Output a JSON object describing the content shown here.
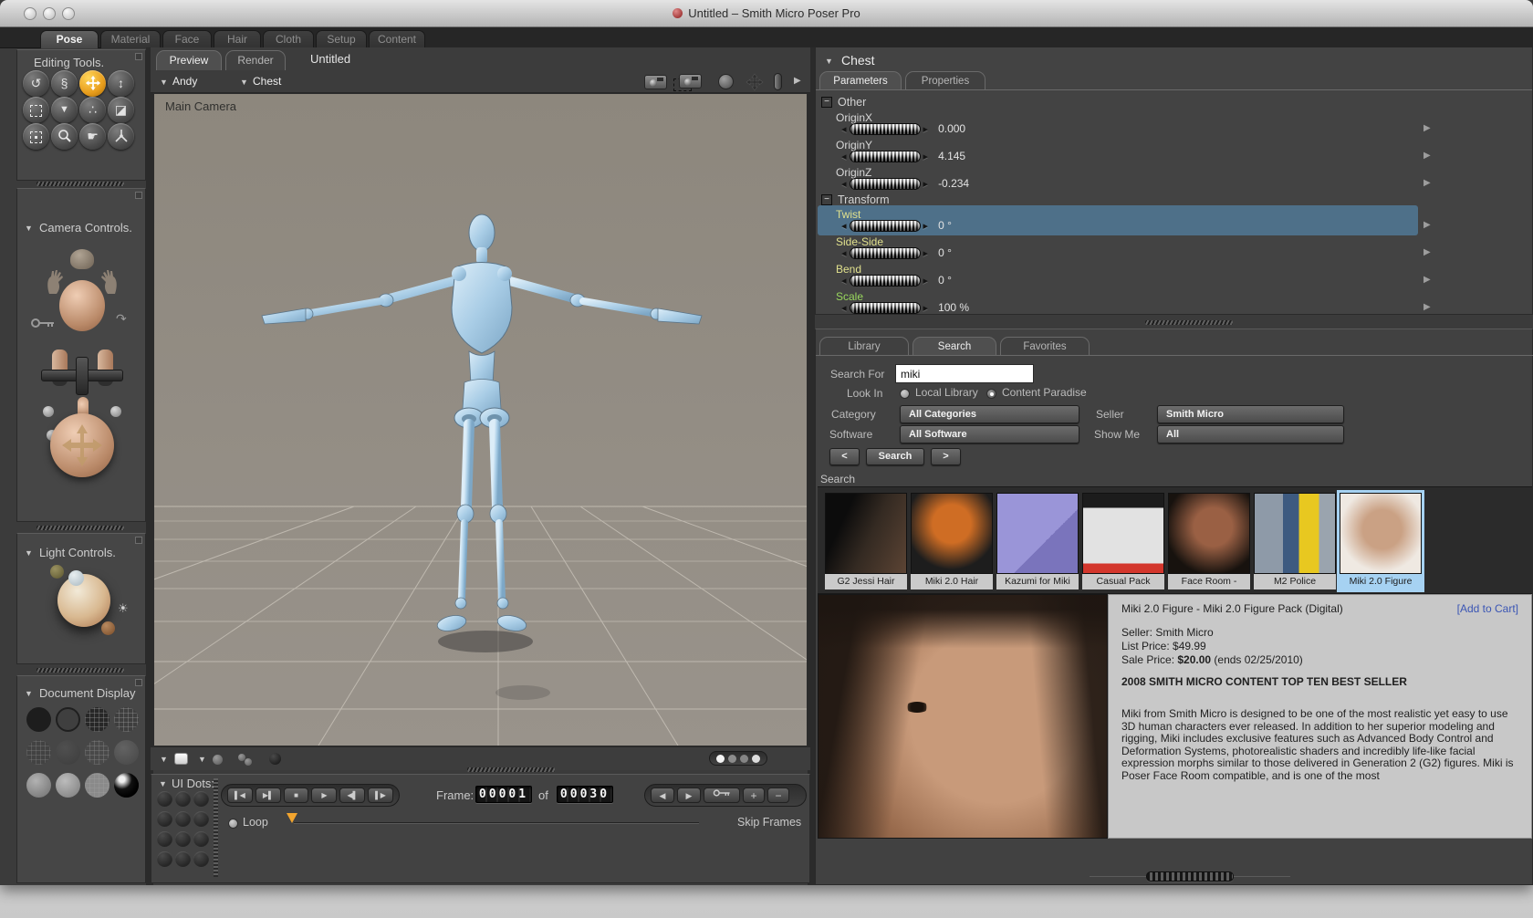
{
  "window": {
    "title": "Untitled – Smith Micro Poser Pro"
  },
  "room_tabs": [
    {
      "label": "Pose"
    },
    {
      "label": "Material"
    },
    {
      "label": "Face"
    },
    {
      "label": "Hair"
    },
    {
      "label": "Cloth"
    },
    {
      "label": "Setup"
    },
    {
      "label": "Content"
    }
  ],
  "left": {
    "editing_tools": {
      "title": "Editing Tools."
    },
    "camera_controls": {
      "title": "Camera Controls."
    },
    "light_controls": {
      "title": "Light Controls."
    },
    "document_display": {
      "title": "Document Display"
    }
  },
  "document": {
    "tab_preview": "Preview",
    "tab_render": "Render",
    "name": "Untitled",
    "actor_figure": "Andy",
    "actor_part": "Chest",
    "camera_label": "Main Camera"
  },
  "animation": {
    "ui_dots": "UI Dots:",
    "frame_label": "Frame:",
    "frame_current": "00001",
    "of_label": "of",
    "frame_total": "00030",
    "loop": "Loop",
    "skip": "Skip Frames"
  },
  "parameters": {
    "actor": "Chest",
    "tab_parameters": "Parameters",
    "tab_properties": "Properties",
    "groups": {
      "other": {
        "name": "Other",
        "params": [
          {
            "label": "OriginX",
            "value": "0.000"
          },
          {
            "label": "OriginY",
            "value": "4.145"
          },
          {
            "label": "OriginZ",
            "value": "-0.234"
          }
        ]
      },
      "transform": {
        "name": "Transform",
        "params": [
          {
            "label": "Twist",
            "value": "0 °"
          },
          {
            "label": "Side-Side",
            "value": "0 °"
          },
          {
            "label": "Bend",
            "value": "0 °"
          },
          {
            "label": "Scale",
            "value": "100 %"
          }
        ]
      }
    }
  },
  "library": {
    "tab_library": "Library",
    "tab_search": "Search",
    "tab_favorites": "Favorites",
    "search_for_label": "Search For",
    "search_value": "miki",
    "look_in_label": "Look In",
    "radio_local": "Local Library",
    "radio_paradise": "Content Paradise",
    "category_label": "Category",
    "category_value": "All Categories",
    "seller_label": "Seller",
    "seller_value": "Smith Micro",
    "software_label": "Software",
    "software_value": "All Software",
    "show_me_label": "Show Me",
    "show_me_value": "All",
    "prev_button": "<",
    "search_button": "Search",
    "next_button": ">",
    "results_label": "Search",
    "thumbnails": [
      {
        "label": "G2 Jessi Hair"
      },
      {
        "label": "Miki 2.0 Hair"
      },
      {
        "label": "Kazumi for Miki"
      },
      {
        "label": "Casual Pack"
      },
      {
        "label": "Face Room -"
      },
      {
        "label": "M2 Police"
      },
      {
        "label": "Miki 2.0 Figure"
      }
    ],
    "product": {
      "title": "Miki 2.0 Figure - Miki 2.0 Figure Pack (Digital)",
      "add_to_cart": "[Add to Cart]",
      "seller": "Seller: Smith Micro",
      "list_price": "List Price: $49.99",
      "sale_price_prefix": "Sale Price: ",
      "sale_price_amount": "$20.00",
      "sale_price_suffix": " (ends 02/25/2010)",
      "best_seller": "2008 SMITH MICRO CONTENT TOP TEN BEST SELLER",
      "description": "Miki from Smith Micro is designed to be one of the most realistic yet easy to use 3D human characters ever released. In addition to her superior modeling and rigging, Miki includes exclusive features such as Advanced Body Control and Deformation Systems, photorealistic shaders and incredibly life-like facial expression morphs similar to those delivered in Generation 2 (G2) figures. Miki is Poser Face Room compatible, and is one of the most"
    }
  },
  "icons": {
    "tri_down": "▼",
    "tri_right": "▶",
    "dial_left": "◂",
    "dial_right": "▸",
    "row_arrow": "▶",
    "minus": "−",
    "rotate": "↺",
    "twist": "§",
    "trans_ud": "↕",
    "taper": "▼",
    "morph": "∴",
    "paint": "◪",
    "color": "☛",
    "curve_arrow": "↷",
    "sun": "☀",
    "tp_first": "▌◀",
    "tp_last": "▶▌",
    "tp_stop": "■",
    "tp_play": "▶",
    "tp_back": "◀▌",
    "tp_fwd": "▌▶",
    "nav_back": "◀",
    "nav_fwd": "▶",
    "plus": "+"
  }
}
